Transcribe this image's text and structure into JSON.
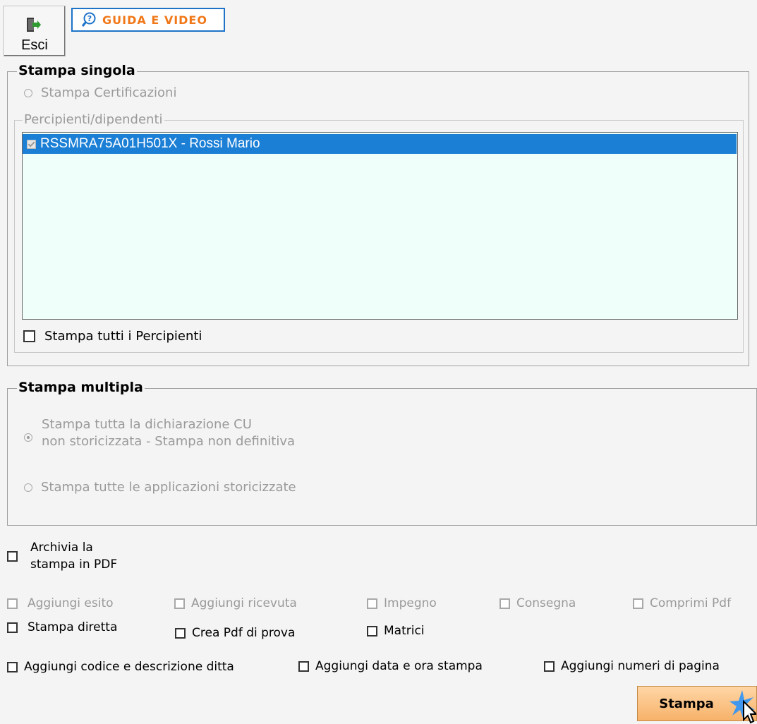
{
  "toolbar": {
    "esci_label": "Esci",
    "guida_label": "GUIDA E VIDEO",
    "icons": {
      "esci": "exit-door-icon",
      "guida": "help-question-icon"
    }
  },
  "stampa_singola": {
    "legend": "Stampa singola",
    "radio_label": "Stampa Certificazioni",
    "list_legend": "Percipienti/dipendenti",
    "items": [
      {
        "label": "RSSMRA75A01H501X - Rossi Mario",
        "checked": true,
        "selected": true
      }
    ],
    "print_all_label": "Stampa tutti i Percipienti"
  },
  "stampa_multipla": {
    "legend": "Stampa multipla",
    "option1_line1": "Stampa tutta la dichiarazione CU",
    "option1_line2": "non storicizzata - Stampa non definitiva",
    "option2": "Stampa tutte le applicazioni storicizzate"
  },
  "options": {
    "archivia_line1": "Archivia la",
    "archivia_line2": "stampa in PDF",
    "aggiungi_esito": "Aggiungi esito",
    "aggiungi_ricevuta": "Aggiungi ricevuta",
    "impegno": "Impegno",
    "consegna": "Consegna",
    "comprimi_pdf": "Comprimi Pdf",
    "stampa_diretta": "Stampa diretta",
    "crea_pdf_prova": "Crea Pdf di prova",
    "matrici": "Matrici",
    "aggiungi_codice": "Aggiungi codice e descrizione ditta",
    "aggiungi_data": "Aggiungi data e ora stampa",
    "aggiungi_numeri": "Aggiungi numeri di pagina"
  },
  "stampa_button": "Stampa",
  "colors": {
    "selection": "#1b7fd6",
    "list_background": "#effffa",
    "help_border": "#1e73c9",
    "help_text": "#f07818",
    "print_button": "#f7b26a"
  }
}
